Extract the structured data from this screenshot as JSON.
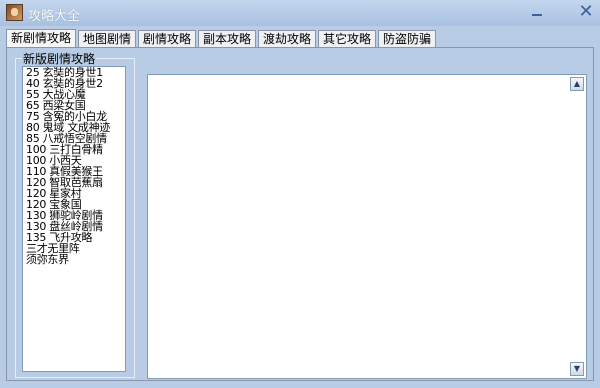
{
  "window": {
    "title": "攻略大全"
  },
  "tabs": [
    {
      "label": "新剧情攻略"
    },
    {
      "label": "地图剧情"
    },
    {
      "label": "剧情攻略"
    },
    {
      "label": "副本攻略"
    },
    {
      "label": "渡劫攻略"
    },
    {
      "label": "其它攻略"
    },
    {
      "label": "防盗防骗"
    }
  ],
  "group": {
    "label": "新版剧情攻略",
    "items": [
      "25 玄奘的身世1",
      "40 玄奘的身世2",
      "55 大战心魔",
      "65 西梁女国",
      "75 含冤的小白龙",
      "80 鬼域 文成神迹",
      "85 八戒悟空剧情",
      "100 三打白骨精",
      "100 小西天",
      "110 真假美猴王",
      "120 智取芭蕉扇",
      "120 星家村",
      "120 宝象国",
      "130 狮驼岭剧情",
      "130 盘丝岭剧情",
      "135 飞升攻略",
      "三才无里阵",
      "须弥东界"
    ]
  },
  "icons": {
    "app": "warrior-portrait-icon",
    "minimize": "minimize-icon",
    "close": "close-icon",
    "scroll_up": "chevron-up-icon",
    "scroll_down": "chevron-down-icon"
  },
  "colors": {
    "window_bg": "#b8cce6",
    "border": "#7f9db9"
  }
}
